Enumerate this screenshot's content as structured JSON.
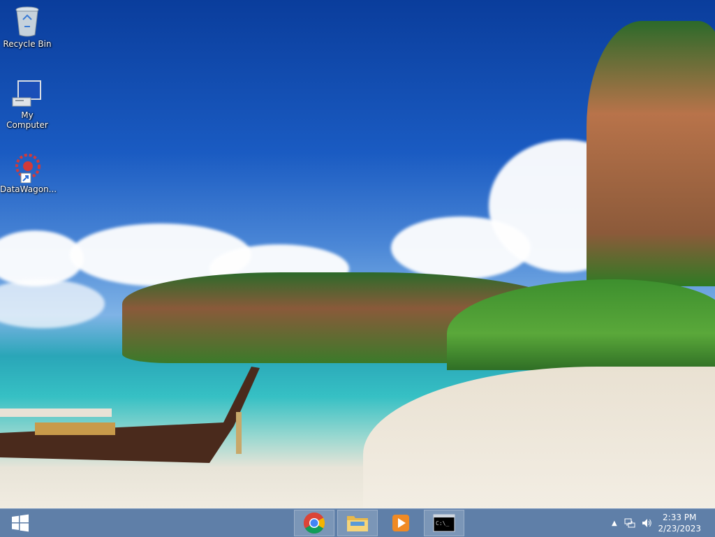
{
  "desktop": {
    "icons": [
      {
        "label": "Recycle Bin",
        "icon": "recycle-bin-icon"
      },
      {
        "label": "My Computer",
        "icon": "computer-icon"
      },
      {
        "label": "DataWagon...",
        "icon": "datawagon-shortcut-icon"
      }
    ]
  },
  "taskbar": {
    "start": {
      "icon": "windows-logo-icon"
    },
    "pinned": [
      {
        "name": "Google Chrome",
        "icon": "chrome-icon"
      },
      {
        "name": "File Explorer",
        "icon": "folder-icon"
      },
      {
        "name": "Media Player",
        "icon": "media-player-icon"
      },
      {
        "name": "Command Prompt",
        "icon": "command-prompt-icon",
        "prompt_text": "C:\\_"
      }
    ],
    "tray": {
      "icons": [
        "show-hidden-icons-arrow",
        "network-icon",
        "volume-icon"
      ],
      "time": "2:33 PM",
      "date": "2/23/2023"
    }
  },
  "colors": {
    "taskbar": "#5f7fa8",
    "sky": "#1a5bc2",
    "sea": "#2aa6b8"
  }
}
